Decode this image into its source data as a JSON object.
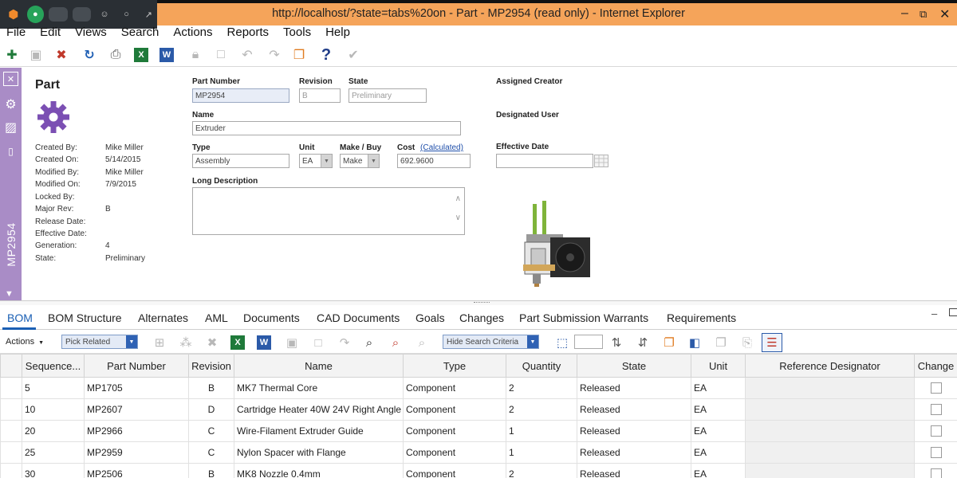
{
  "window": {
    "title": "http://localhost/?state=tabs%20on - Part - MP2954 (read only) - Internet Explorer"
  },
  "menu": [
    "File",
    "Edit",
    "Views",
    "Search",
    "Actions",
    "Reports",
    "Tools",
    "Help"
  ],
  "part": {
    "heading": "Part",
    "meta_labels": [
      "Created By:",
      "Created On:",
      "Modified By:",
      "Modified On:",
      "Locked By:",
      "Major Rev:",
      "Release Date:",
      "Effective Date:",
      "Generation:",
      "State:"
    ],
    "meta_values": [
      "Mike Miller",
      "5/14/2015",
      "Mike Miller",
      "7/9/2015",
      "",
      "B",
      "",
      "",
      "4",
      "Preliminary"
    ],
    "sidebar_label": "MP2954"
  },
  "form": {
    "labels": {
      "part_number": "Part Number",
      "revision": "Revision",
      "state": "State",
      "name": "Name",
      "type": "Type",
      "unit": "Unit",
      "make_buy": "Make / Buy",
      "cost": "Cost",
      "cost_link": "(Calculated)",
      "long_description": "Long Description",
      "assigned_creator": "Assigned Creator",
      "designated_user": "Designated User",
      "effective_date": "Effective Date"
    },
    "values": {
      "part_number": "MP2954",
      "revision": "B",
      "state": "Preliminary",
      "name": "Extruder",
      "type": "Assembly",
      "unit": "EA",
      "make_buy": "Make",
      "cost": "692.9600",
      "long_description": "",
      "effective_date": ""
    }
  },
  "tabs": [
    "BOM",
    "BOM Structure",
    "Alternates",
    "AML",
    "Documents",
    "CAD Documents",
    "Goals",
    "Changes",
    "Part Submission Warrants",
    "Requirements"
  ],
  "grid_toolbar": {
    "actions_label": "Actions",
    "pick_related": "Pick Related",
    "hide_search": "Hide Search Criteria"
  },
  "grid": {
    "columns": [
      "",
      "Sequence...",
      "Part Number",
      "Revision",
      "Name",
      "Type",
      "Quantity",
      "State",
      "Unit",
      "Reference Designator",
      "Change"
    ],
    "rows": [
      [
        "5",
        "MP1705",
        "B",
        "MK7 Thermal Core",
        "Component",
        "2",
        "Released",
        "EA",
        ""
      ],
      [
        "10",
        "MP2607",
        "D",
        "Cartridge Heater 40W 24V Right Angle",
        "Component",
        "2",
        "Released",
        "EA",
        ""
      ],
      [
        "20",
        "MP2966",
        "C",
        "Wire-Filament Extruder Guide",
        "Component",
        "1",
        "Released",
        "EA",
        ""
      ],
      [
        "25",
        "MP2959",
        "C",
        "Nylon Spacer with Flange",
        "Component",
        "1",
        "Released",
        "EA",
        ""
      ],
      [
        "30",
        "MP2506",
        "B",
        "MK8 Nozzle 0.4mm",
        "Component",
        "2",
        "Released",
        "EA",
        ""
      ]
    ]
  },
  "colors": {
    "titlebar": "#f5a45a",
    "rail": "#a98cc6",
    "accent": "#1a5fb4",
    "gear": "#7b4fb3"
  }
}
